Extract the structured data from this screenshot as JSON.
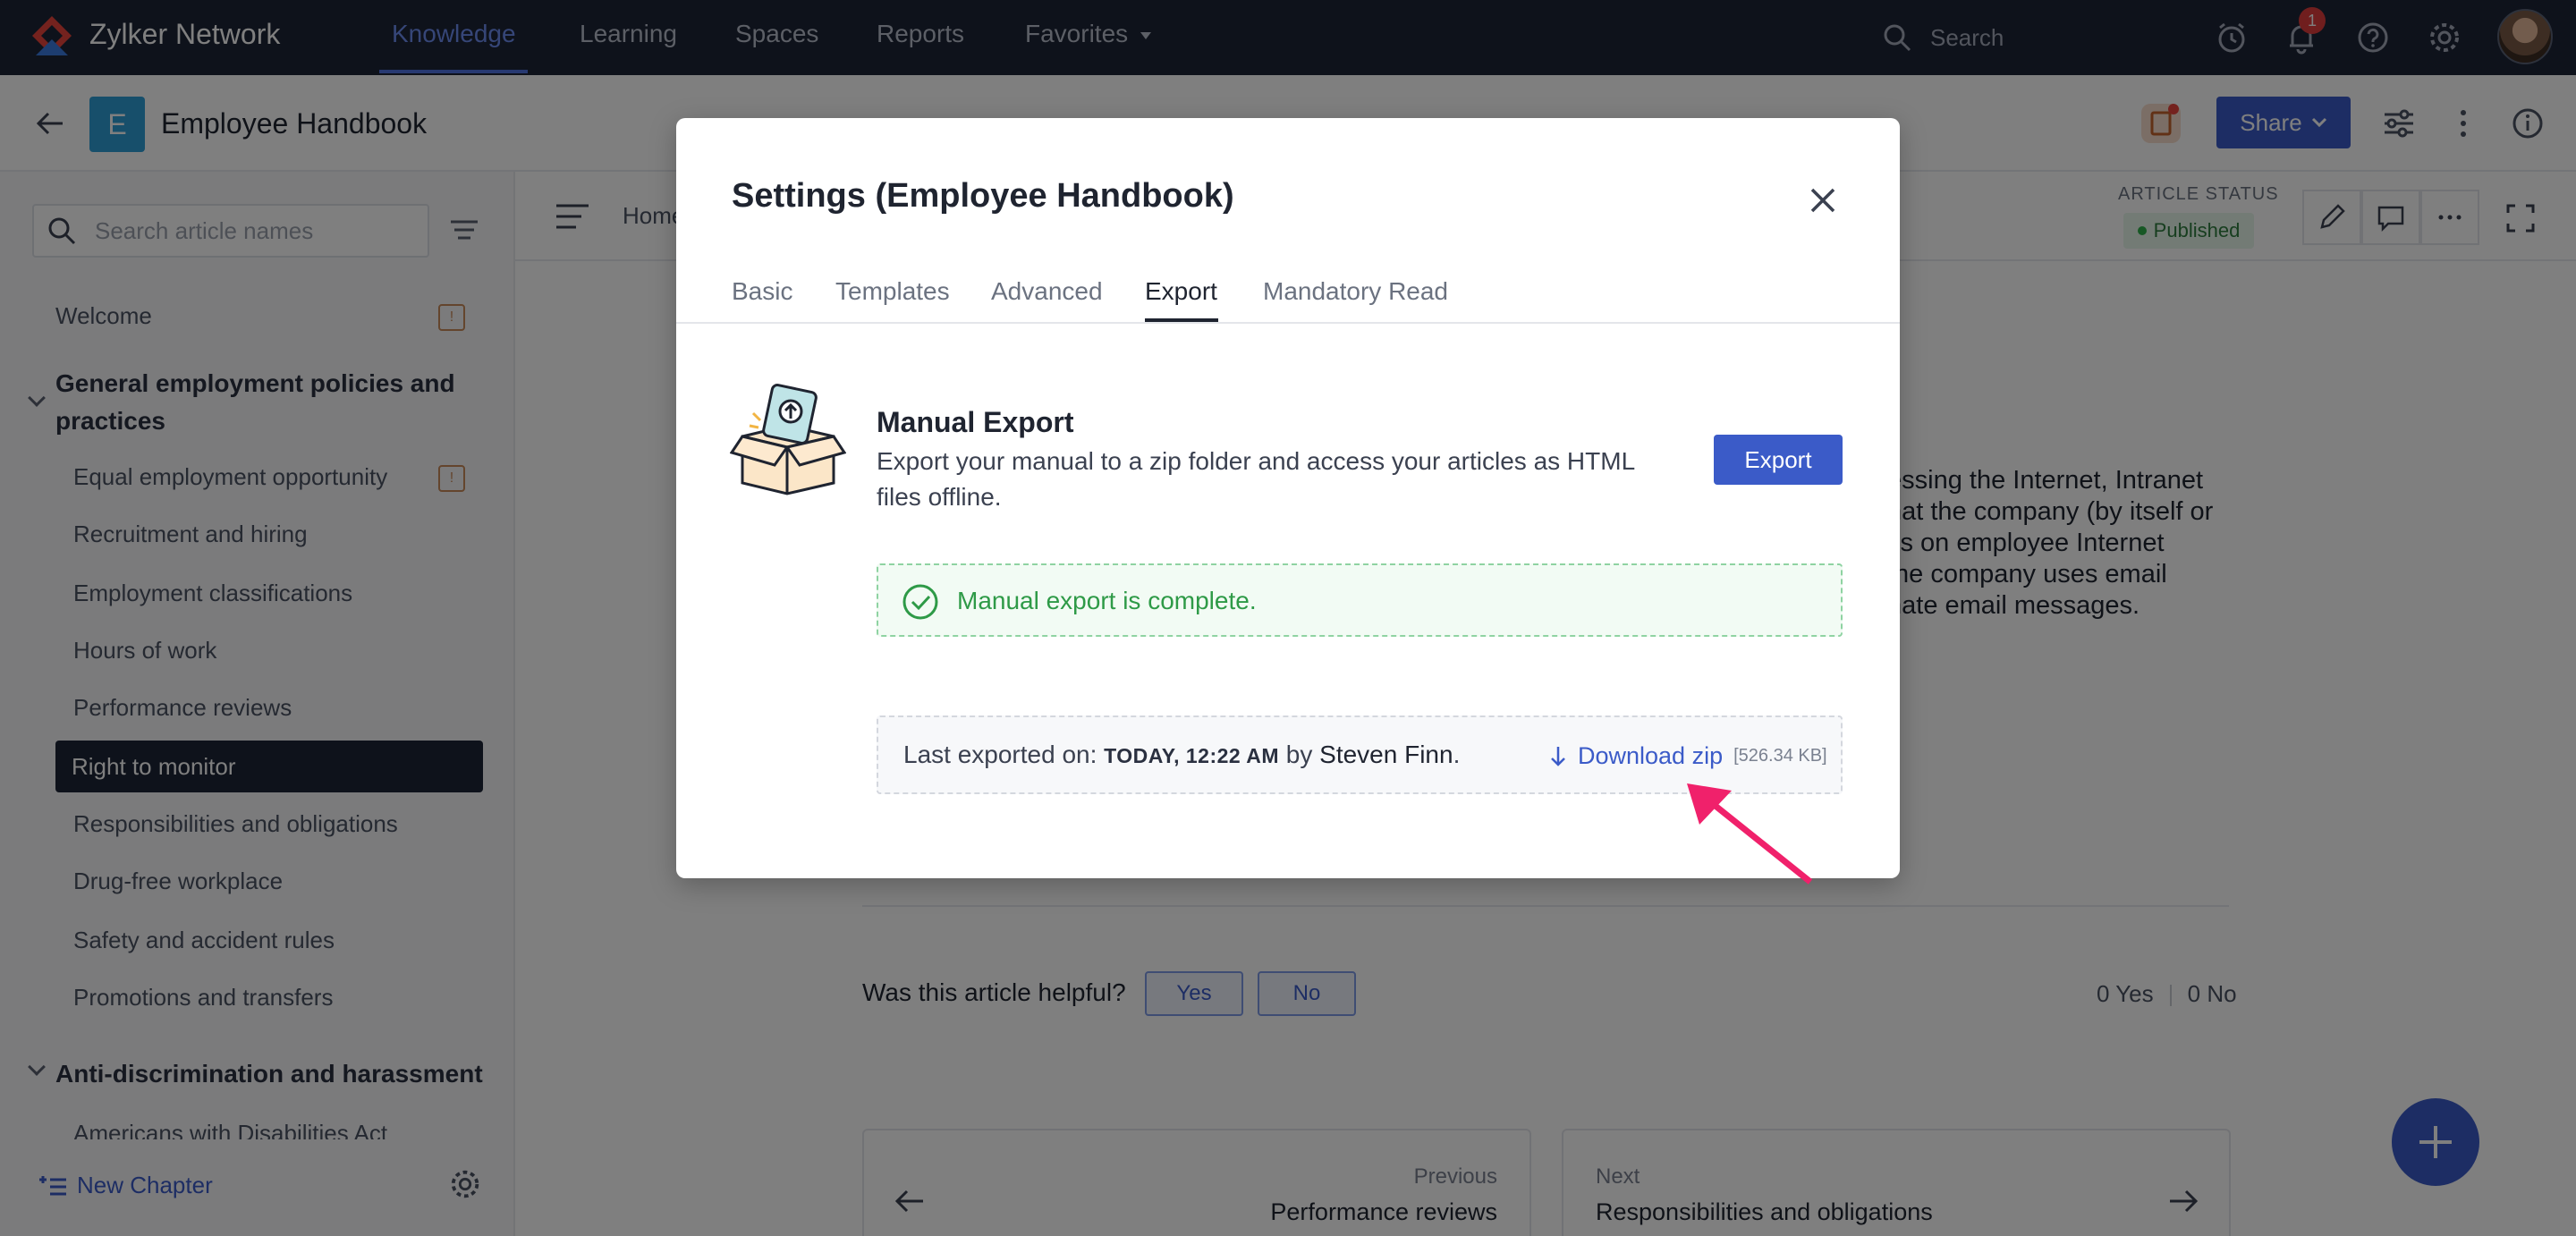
{
  "topnav": {
    "brand": "Zylker Network",
    "items": [
      {
        "label": "Knowledge",
        "active": true
      },
      {
        "label": "Learning"
      },
      {
        "label": "Spaces"
      },
      {
        "label": "Reports"
      },
      {
        "label": "Favorites"
      }
    ],
    "search_placeholder": "Search",
    "notification_count": "1",
    "icons": [
      "alarm-clock-icon",
      "bell-icon",
      "help-icon",
      "gear-icon"
    ]
  },
  "subheader": {
    "badge_letter": "E",
    "title": "Employee Handbook",
    "share_label": "Share"
  },
  "sidebar": {
    "search_placeholder": "Search article names",
    "welcome": "Welcome",
    "chapter1": {
      "title_line1": "General employment policies and",
      "title_line2": "practices",
      "items": [
        "Equal employment opportunity",
        "Recruitment and hiring",
        "Employment classifications",
        "Hours of work",
        "Performance reviews",
        "Right to monitor",
        "Responsibilities and obligations",
        "Drug-free workplace",
        "Safety and accident rules",
        "Promotions and transfers"
      ],
      "active_index": 5
    },
    "chapter2": {
      "title": "Anti-discrimination and harassment",
      "items": [
        "Americans with Disabilities Act"
      ]
    },
    "new_chapter": "New Chapter"
  },
  "content": {
    "breadcrumb": "Home",
    "status_label": "ARTICLE STATUS",
    "status_value": "Published",
    "article_lines": [
      "essing the Internet, Intranet",
      "hat the company (by itself or",
      "cs on employee Internet",
      "the company uses email",
      "nate email messages."
    ],
    "helpful_question": "Was this article helpful?",
    "yes_label": "Yes",
    "no_label": "No",
    "yes_count": "0 Yes",
    "no_count": "0 No",
    "previous": {
      "label": "Previous",
      "title": "Performance reviews"
    },
    "next": {
      "label": "Next",
      "title": "Responsibilities and obligations"
    }
  },
  "modal": {
    "title": "Settings (Employee Handbook)",
    "tabs": [
      {
        "label": "Basic"
      },
      {
        "label": "Templates"
      },
      {
        "label": "Advanced"
      },
      {
        "label": "Export",
        "active": true
      },
      {
        "label": "Mandatory Read"
      }
    ],
    "section_title": "Manual Export",
    "section_desc": "Export your manual to a zip folder and access your articles as HTML files offline.",
    "export_button": "Export",
    "success_message": "Manual export is complete.",
    "last_exported_prefix": "Last exported on:",
    "last_exported_when": "TODAY, 12:22 AM",
    "last_exported_by": "by",
    "last_exported_user": "Steven Finn",
    "period": ".",
    "download_label": "Download zip",
    "download_size": "[526.34 KB]"
  },
  "colors": {
    "nav_bg": "#1d2436",
    "accent": "#3b5bc8",
    "success": "#2e9a47",
    "annotation_arrow": "#f0216b"
  }
}
